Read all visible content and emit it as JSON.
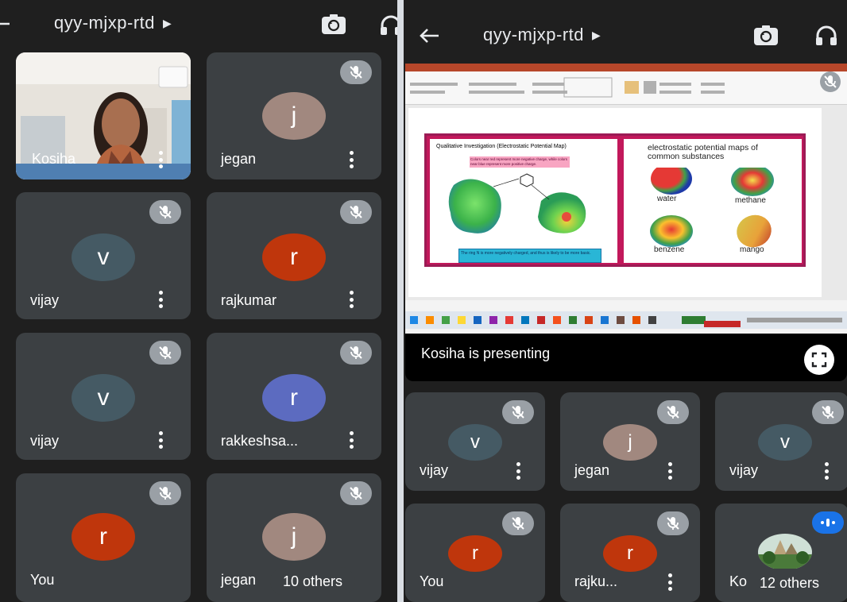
{
  "left": {
    "meeting_code": "qyy-mjxp-rtd",
    "tiles": [
      {
        "name": "Kosiha",
        "initial": "",
        "muted": false,
        "color": ""
      },
      {
        "name": "jegan",
        "initial": "j",
        "muted": true,
        "color": "#a1887f"
      },
      {
        "name": "vijay",
        "initial": "v",
        "muted": true,
        "color": "#455a64"
      },
      {
        "name": "rajkumar",
        "initial": "r",
        "muted": true,
        "color": "#bf360c"
      },
      {
        "name": "vijay",
        "initial": "v",
        "muted": true,
        "color": "#455a64"
      },
      {
        "name": "rakkeshsa...",
        "initial": "r",
        "muted": true,
        "color": "#5c6bc0"
      },
      {
        "name": "You",
        "initial": "r",
        "muted": true,
        "color": "#bf360c"
      },
      {
        "name": "jegan",
        "initial": "j",
        "muted": true,
        "color": "#a1887f"
      }
    ],
    "others_label": "10 others"
  },
  "right": {
    "meeting_code": "qyy-mjxp-rtd",
    "presenting_label": "Kosiha is presenting",
    "slide": {
      "left_heading": "Qualitative Investigation (Electrostatic Potential Map)",
      "pink_note": "Colors near red represent more negative charge, while colors near blue represent more positive charge.",
      "blue_note": "The ring N is more negatively charged, and thus is likely to be more basic.",
      "right_heading": "electrostatic potential maps of common substances",
      "labels": [
        "water",
        "methane",
        "benzene",
        "mango"
      ]
    },
    "tiles": [
      {
        "name": "vijay",
        "initial": "v",
        "color": "#455a64"
      },
      {
        "name": "jegan",
        "initial": "j",
        "color": "#a1887f"
      },
      {
        "name": "vijay",
        "initial": "v",
        "color": "#455a64"
      },
      {
        "name": "You",
        "initial": "r",
        "color": "#bf360c"
      },
      {
        "name": "rajku...",
        "initial": "r",
        "color": "#bf360c"
      },
      {
        "name": "Kosiha",
        "initial": "",
        "color": ""
      }
    ],
    "others_label": "12 others"
  },
  "icons": [
    "back-arrow-icon",
    "camera-flip-icon",
    "headphones-icon",
    "mic-off-icon",
    "more-vert-icon",
    "fullscreen-icon"
  ],
  "colors": {
    "background": "#1f1f1f",
    "tile": "#3c4043",
    "mute_chip": "#9aa0a6",
    "speaking_chip": "#1a73e8"
  }
}
